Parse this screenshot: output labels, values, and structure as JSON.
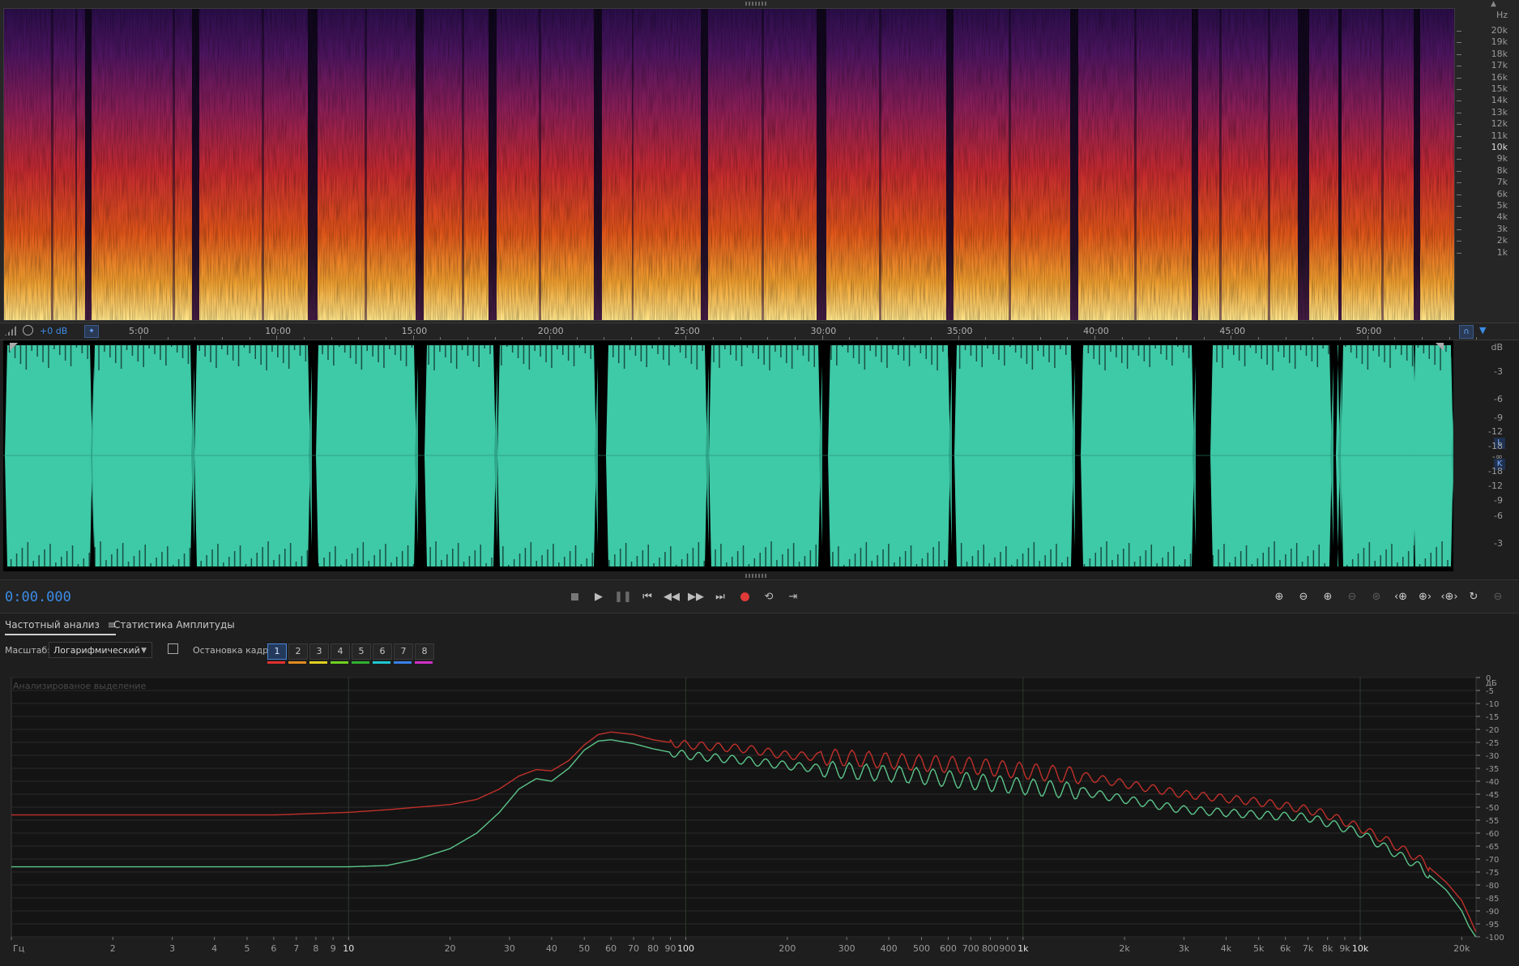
{
  "spectral": {
    "unit": "Hz",
    "freq_labels": [
      "20k",
      "19k",
      "18k",
      "17k",
      "16k",
      "15k",
      "14k",
      "13k",
      "12k",
      "11k",
      "10k",
      "9k",
      "8k",
      "7k",
      "6k",
      "5k",
      "4k",
      "3k",
      "2k",
      "1k"
    ]
  },
  "ruler": {
    "level_label": "+0 dB",
    "time_labels": [
      "5:00",
      "10:00",
      "15:00",
      "20:00",
      "25:00",
      "30:00",
      "35:00",
      "40:00",
      "45:00",
      "50:00"
    ]
  },
  "waveform": {
    "unit": "dB",
    "db_labels_top": [
      "-3",
      "-6",
      "-9",
      "-12",
      "-18"
    ],
    "center_label": "-∞",
    "db_labels_bottom": [
      "-18",
      "-12",
      "-9",
      "-6",
      "-3"
    ],
    "channel_top": "L",
    "channel_bottom": "K"
  },
  "transport": {
    "time": "0:00.000",
    "record_color": "#e03a3a"
  },
  "analysis": {
    "tab_freq": "Частотный анализ",
    "tab_amp": "Статистика Амплитуды",
    "scale_label": "Масштаб:",
    "scale_value": "Логарифмический",
    "hold_label": "Остановка кадра:",
    "holds": [
      "1",
      "2",
      "3",
      "4",
      "5",
      "6",
      "7",
      "8"
    ],
    "hold_colors": [
      "#e03030",
      "#e08a20",
      "#e0d020",
      "#70d020",
      "#30b030",
      "#20c8d0",
      "#3a80e8",
      "#d030c8"
    ],
    "selected_hold": "1",
    "plot_caption": "Анализированое выделение"
  },
  "chart_data": {
    "type": "line",
    "title": "",
    "xlabel": "Гц",
    "ylabel": "дБ",
    "x_scale": "log",
    "xlim": [
      1,
      22050
    ],
    "ylim": [
      -100,
      0
    ],
    "x_tick_labels": [
      "Гц",
      "2",
      "3",
      "4",
      "5",
      "6",
      "7",
      "8",
      "9",
      "10",
      "20",
      "30",
      "40",
      "50",
      "60",
      "70",
      "80",
      "90",
      "100",
      "200",
      "300",
      "400",
      "500",
      "600",
      "700",
      "800",
      "900",
      "1k",
      "2k",
      "3k",
      "4k",
      "5k",
      "6k",
      "7k",
      "8k",
      "9k",
      "10k",
      "20k"
    ],
    "y_tick_labels": [
      "дБ",
      "0",
      "-5",
      "-10",
      "-15",
      "-20",
      "-25",
      "-30",
      "-35",
      "-40",
      "-45",
      "-50",
      "-55",
      "-60",
      "-65",
      "-70",
      "-75",
      "-80",
      "-85",
      "-90",
      "-95",
      "-100"
    ],
    "x": [
      1,
      3,
      6,
      10,
      13,
      16,
      20,
      24,
      28,
      32,
      36,
      40,
      45,
      50,
      55,
      60,
      70,
      80,
      100,
      150,
      200,
      300,
      500,
      700,
      1000,
      1500,
      2000,
      3000,
      5000,
      7000,
      8000,
      10000,
      12000,
      15000,
      18000,
      20000,
      21000,
      22000
    ],
    "series": [
      {
        "color": "#c0302a",
        "values": [
          -53,
          -53,
          -53,
          -52,
          -51,
          -50,
          -49,
          -47,
          -43,
          -38,
          -35.5,
          -36,
          -32,
          -26,
          -22,
          -21,
          -22,
          -24,
          -26,
          -27.5,
          -30,
          -31,
          -33,
          -34,
          -36,
          -38,
          -41,
          -45,
          -48,
          -51,
          -53,
          -58,
          -63,
          -70,
          -79,
          -86,
          -92,
          -98
        ]
      },
      {
        "color": "#5cc48a",
        "values": [
          -73,
          -73,
          -73,
          -73,
          -72.5,
          -70,
          -66,
          -60,
          -52,
          -43,
          -39,
          -40,
          -35,
          -28,
          -24.5,
          -24,
          -25.5,
          -27.5,
          -30,
          -32,
          -34,
          -36,
          -38,
          -40,
          -42,
          -44,
          -47,
          -51,
          -53,
          -54,
          -56,
          -60,
          -66,
          -73,
          -82,
          -90,
          -96,
          -100
        ]
      }
    ]
  }
}
